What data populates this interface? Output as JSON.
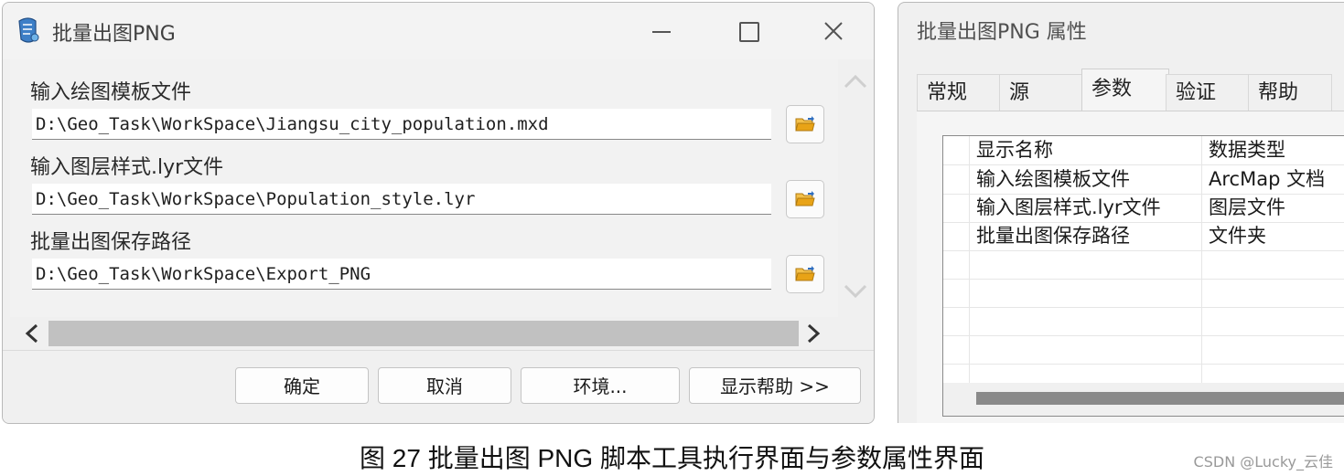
{
  "tool_dialog": {
    "title": "批量出图PNG",
    "fields": [
      {
        "label": "输入绘图模板文件",
        "value": "D:\\Geo_Task\\WorkSpace\\Jiangsu_city_population.mxd"
      },
      {
        "label": "输入图层样式.lyr文件",
        "value": "D:\\Geo_Task\\WorkSpace\\Population_style.lyr"
      },
      {
        "label": "批量出图保存路径",
        "value": "D:\\Geo_Task\\WorkSpace\\Export_PNG"
      }
    ],
    "buttons": {
      "ok": "确定",
      "cancel": "取消",
      "environments": "环境...",
      "show_help": "显示帮助 >>"
    }
  },
  "properties_dialog": {
    "title": "批量出图PNG 属性",
    "tabs": [
      "常规",
      "源",
      "参数",
      "验证",
      "帮助"
    ],
    "active_tab": "参数",
    "table": {
      "headers": [
        "显示名称",
        "数据类型"
      ],
      "rows": [
        [
          "输入绘图模板文件",
          "ArcMap 文档"
        ],
        [
          "输入图层样式.lyr文件",
          "图层文件"
        ],
        [
          "批量出图保存路径",
          "文件夹"
        ]
      ]
    }
  },
  "caption": "图  27  批量出图 PNG 脚本工具执行界面与参数属性界面",
  "watermark": "CSDN @Lucky_云佳",
  "colors": {
    "folder_icon": "#e8a317",
    "scrollbar_thumb": "#c1c1c1",
    "dialog_bg": "#f0f0f0"
  }
}
